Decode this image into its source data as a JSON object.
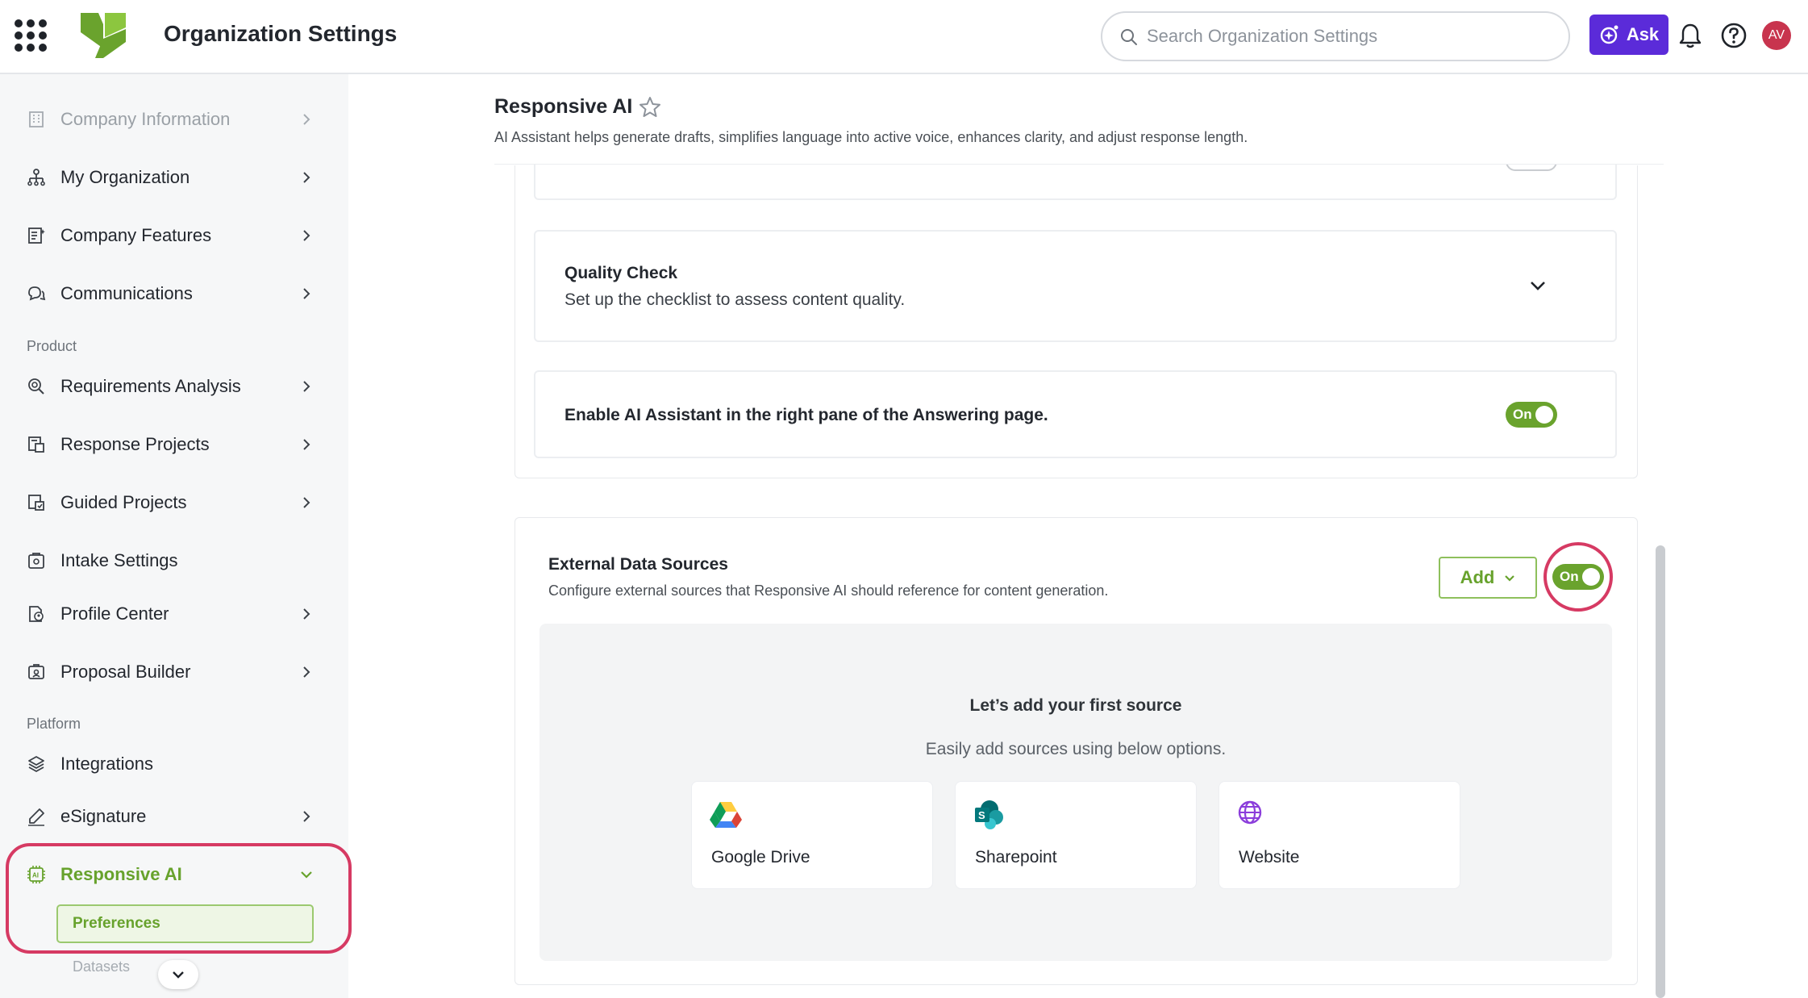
{
  "header": {
    "app_title": "Organization Settings",
    "search_placeholder": "Search Organization Settings",
    "ask_label": "Ask",
    "avatar_initials": "AV"
  },
  "sidebar": {
    "items_top": [
      {
        "label": "Company Information",
        "icon": "building-icon",
        "disabled": true
      },
      {
        "label": "My Organization",
        "icon": "org-chart-icon"
      },
      {
        "label": "Company Features",
        "icon": "features-list-icon"
      },
      {
        "label": "Communications",
        "icon": "chat-bubbles-icon"
      }
    ],
    "section_product": "Product",
    "items_product": [
      {
        "label": "Requirements Analysis",
        "icon": "magnifier-analysis-icon"
      },
      {
        "label": "Response Projects",
        "icon": "projects-icon"
      },
      {
        "label": "Guided Projects",
        "icon": "guided-projects-icon"
      },
      {
        "label": "Intake Settings",
        "icon": "intake-settings-icon"
      },
      {
        "label": "Profile Center",
        "icon": "profile-document-icon"
      },
      {
        "label": "Proposal Builder",
        "icon": "proposal-builder-icon"
      }
    ],
    "section_platform": "Platform",
    "items_platform": [
      {
        "label": "Integrations",
        "icon": "layers-icon"
      },
      {
        "label": "eSignature",
        "icon": "pen-signature-icon"
      },
      {
        "label": "Responsive AI",
        "icon": "ai-chip-icon",
        "active": true
      }
    ],
    "sub_items": [
      "Preferences",
      "Datasets"
    ]
  },
  "main": {
    "title": "Responsive AI",
    "description": "AI Assistant helps generate drafts, simplifies language into active voice, enhances clarity, and adjust response length.",
    "quality_check": {
      "title": "Quality Check",
      "subtitle": "Set up the checklist to assess content quality."
    },
    "enable_assistant": {
      "title": "Enable AI Assistant in the right pane of the Answering page.",
      "toggle_label": "On"
    },
    "external_sources": {
      "title": "External Data Sources",
      "description": "Configure external sources that Responsive AI should reference for content generation.",
      "add_label": "Add",
      "toggle_label": "On",
      "empty_title": "Let’s add your first source",
      "empty_subtitle": "Easily add sources using below options.",
      "sources": [
        {
          "label": "Google Drive",
          "icon": "google-drive-icon"
        },
        {
          "label": "Sharepoint",
          "icon": "sharepoint-icon"
        },
        {
          "label": "Website",
          "icon": "globe-icon"
        }
      ]
    }
  },
  "colors": {
    "accent_green": "#6aa32d",
    "ask_purple": "#5b2bd9",
    "highlight_ring": "#d63a63",
    "avatar": "#c8344e"
  }
}
